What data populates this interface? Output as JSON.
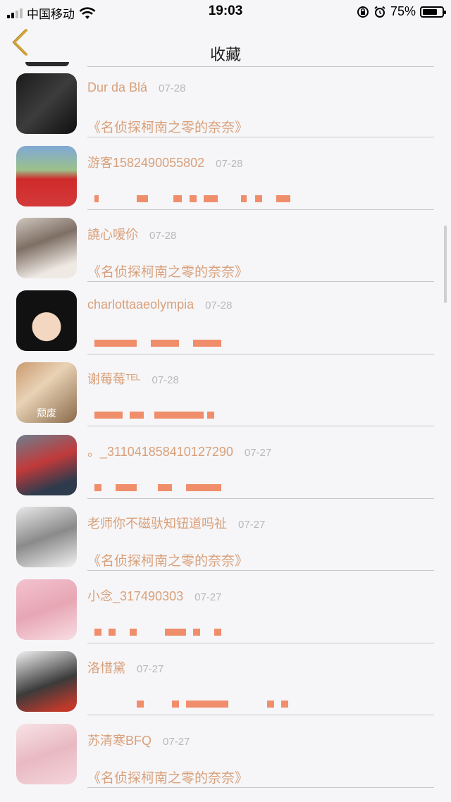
{
  "status_bar": {
    "carrier": "中国移动",
    "time": "19:03",
    "battery_percent": "75%",
    "battery_level": 0.75
  },
  "nav": {
    "title": "收藏",
    "back_icon": "chevron-left-icon"
  },
  "colors": {
    "accent": "#d9a07a",
    "date": "#b8b8bc",
    "divider": "#c8c8cc",
    "background": "#f6f6f8"
  },
  "items": [
    {
      "name": "Dur da Blá",
      "date": "07-28",
      "subtitle": "《名侦探柯南之零的奈奈》",
      "avatar_label": ""
    },
    {
      "name": "游客1582490055802",
      "date": "07-28",
      "subtitle": "",
      "avatar_label": ""
    },
    {
      "name": "譊心嗳伱",
      "date": "07-28",
      "subtitle": "《名侦探柯南之零的奈奈》",
      "avatar_label": ""
    },
    {
      "name": "charlottaaeolympia",
      "date": "07-28",
      "subtitle": "",
      "avatar_label": ""
    },
    {
      "name": "谢莓莓ᵀᴱᴸ",
      "date": "07-28",
      "subtitle": "",
      "avatar_label": "颓废"
    },
    {
      "name": "。_311041858410127290",
      "date": "07-27",
      "subtitle": "",
      "avatar_label": ""
    },
    {
      "name": "老师你不磁驮知钮道吗祉",
      "date": "07-27",
      "subtitle": "《名侦探柯南之零的奈奈》",
      "avatar_label": ""
    },
    {
      "name": "小念_317490303",
      "date": "07-27",
      "subtitle": "",
      "avatar_label": ""
    },
    {
      "name": "洛惜黛",
      "date": "07-27",
      "subtitle": "",
      "avatar_label": ""
    },
    {
      "name": "苏清寒BFQ",
      "date": "07-27",
      "subtitle": "《名侦探柯南之零的奈奈》",
      "avatar_label": ""
    }
  ]
}
